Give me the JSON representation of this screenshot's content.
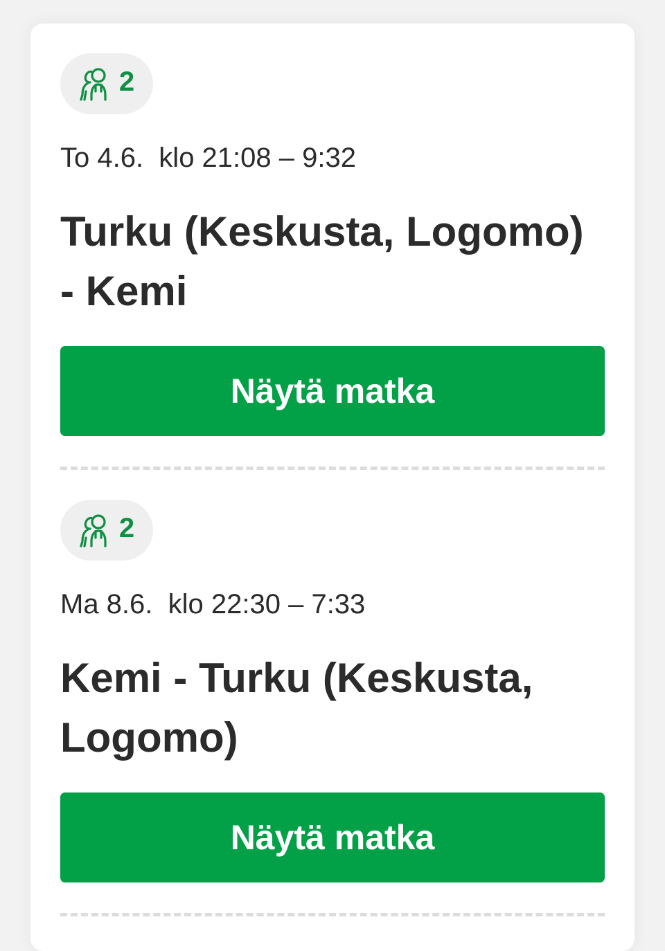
{
  "trips": [
    {
      "passengers": "2",
      "datetime": "To 4.6.  klo 21:08 – 9:32",
      "route": "Turku (Keskusta, Logomo) - Kemi",
      "button_label": "Näytä matka"
    },
    {
      "passengers": "2",
      "datetime": "Ma 8.6.  klo 22:30 – 7:33",
      "route": "Kemi - Turku (Keskusta, Logomo)",
      "button_label": "Näytä matka"
    }
  ],
  "colors": {
    "accent_green": "#03a147",
    "icon_green": "#0f8f43",
    "badge_bg": "#efefef",
    "text": "#2b2b2b"
  },
  "icons": {
    "passenger": "passengers-icon"
  }
}
